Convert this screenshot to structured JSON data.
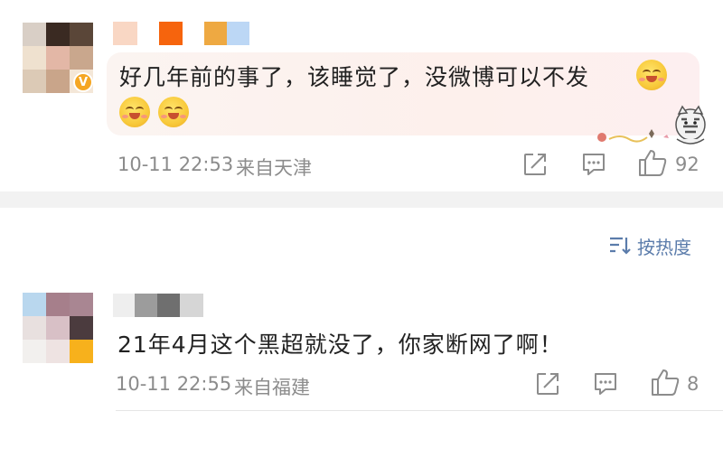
{
  "comments": [
    {
      "text_line1": "好几年前的事了，该睡觉了，没微博可以不发",
      "time": "10-11 22:53",
      "location": "来自天津",
      "likes": "92",
      "badge_symbol": "V"
    },
    {
      "text": "21年4月这个黑超就没了，你家断网了啊！",
      "time": "10-11 22:55",
      "location": "来自福建",
      "likes": "8"
    }
  ],
  "sort": {
    "label": "按热度"
  },
  "icons": {
    "share": "share-icon",
    "comment": "comment-icon",
    "like": "thumbs-up-icon",
    "sort": "sort-icon",
    "emoji": "hug-smile-emoji",
    "sticker": "cat-sticker"
  },
  "colors": {
    "link_blue": "#5b7cab",
    "meta_gray": "#8c8c8c",
    "badge_gold": "#f5a623"
  }
}
